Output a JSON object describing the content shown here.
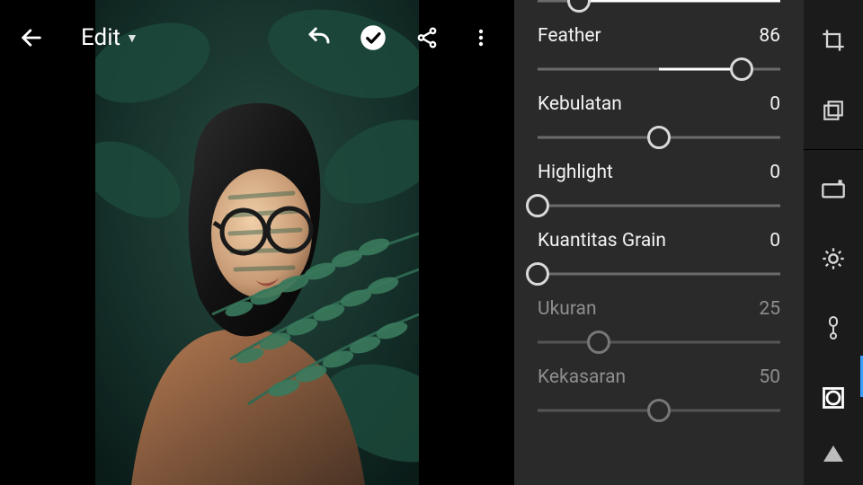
{
  "topbar": {
    "title": "Edit"
  },
  "sliders": [
    {
      "key": "top",
      "label": "",
      "value": "",
      "thumb_pct": 17,
      "fill_start_pct": 17,
      "fill_end_pct": 100,
      "partial_top": true
    },
    {
      "key": "feather",
      "label": "Feather",
      "value": "86",
      "thumb_pct": 84,
      "fill_start_pct": 50,
      "fill_end_pct": 84
    },
    {
      "key": "roundness",
      "label": "Kebulatan",
      "value": "0",
      "thumb_pct": 50,
      "fill_start_pct": 50,
      "fill_end_pct": 50
    },
    {
      "key": "highlight",
      "label": "Highlight",
      "value": "0",
      "thumb_pct": 0,
      "fill_start_pct": 0,
      "fill_end_pct": 0
    },
    {
      "key": "grain",
      "label": "Kuantitas Grain",
      "value": "0",
      "thumb_pct": 0,
      "fill_start_pct": 0,
      "fill_end_pct": 0
    },
    {
      "key": "size",
      "label": "Ukuran",
      "value": "25",
      "thumb_pct": 25,
      "fill_start_pct": 0,
      "fill_end_pct": 0,
      "dim": true
    },
    {
      "key": "roughness",
      "label": "Kekasaran",
      "value": "50",
      "thumb_pct": 50,
      "fill_start_pct": 0,
      "fill_end_pct": 0,
      "dim": true
    }
  ],
  "rail": {
    "active_index": 5,
    "items": [
      {
        "name": "crop-icon"
      },
      {
        "name": "layers-icon"
      },
      {
        "name": "healing-icon"
      },
      {
        "name": "light-icon"
      },
      {
        "name": "color-icon"
      },
      {
        "name": "optics-icon"
      }
    ]
  }
}
